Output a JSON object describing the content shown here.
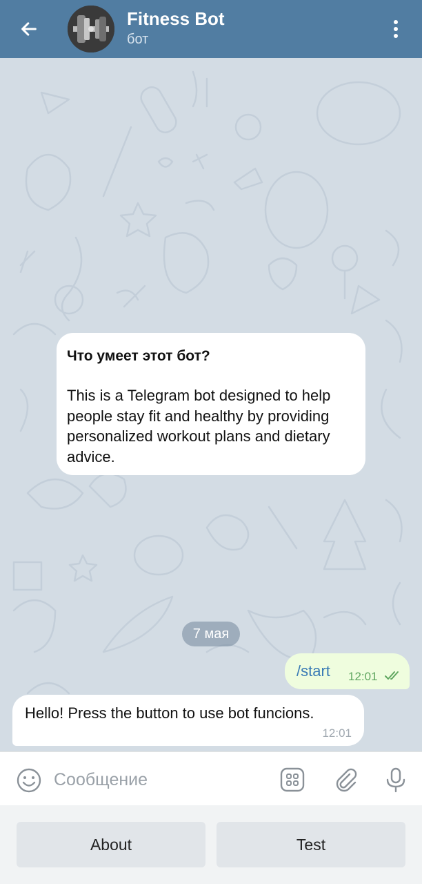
{
  "header": {
    "title": "Fitness Bot",
    "subtitle": "бот",
    "background": "#517da2"
  },
  "chat": {
    "intro": {
      "heading": "Что умеет этот бот?",
      "text": "This is a Telegram bot designed to help people stay fit and healthy by providing personalized workout plans and dietary advice."
    },
    "date_chip": "7 мая",
    "messages": [
      {
        "direction": "outgoing",
        "text": "/start",
        "time": "12:01",
        "status": "read"
      },
      {
        "direction": "incoming",
        "text": "Hello! Press the button to use bot funcions.",
        "time": "12:01"
      }
    ]
  },
  "input": {
    "placeholder": "Сообщение"
  },
  "keyboard": {
    "buttons": [
      {
        "label": "About"
      },
      {
        "label": "Test"
      }
    ]
  },
  "icons": {
    "back": "arrow-left-icon",
    "menu": "more-vertical-icon",
    "emoji": "emoji-icon",
    "commands": "bot-commands-icon",
    "attach": "paperclip-icon",
    "mic": "microphone-icon"
  }
}
